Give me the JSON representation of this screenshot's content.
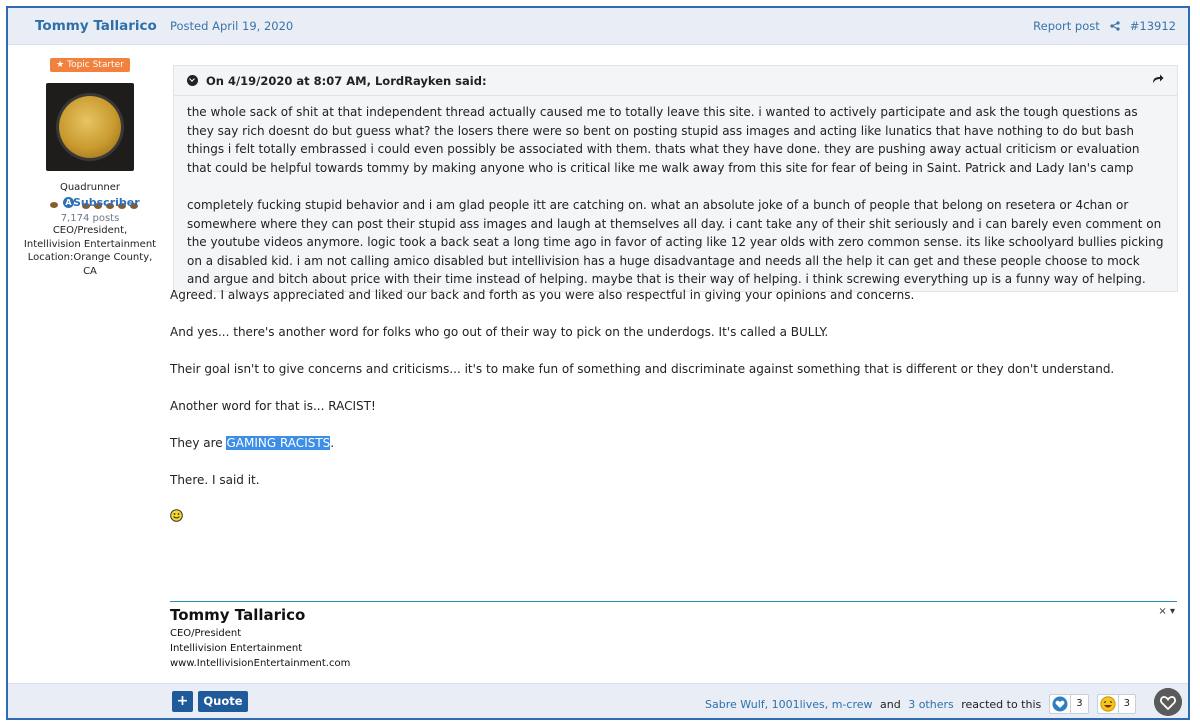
{
  "header": {
    "author": "Tommy Tallarico",
    "posted": "Posted April 19, 2020",
    "report": "Report post",
    "post_number": "#13912"
  },
  "sidebar": {
    "badge": "★ Topic Starter",
    "rank": "Quadrunner",
    "subscriber": "Subscriber",
    "posts": "7,174 posts",
    "meta": [
      "CEO/President,",
      "Intellivision Entertainment",
      "Location:Orange County,",
      "CA"
    ]
  },
  "quote": {
    "header": "On 4/19/2020 at 8:07 AM, LordRayken said:",
    "paragraphs": [
      "the whole sack of shit at that independent thread actually caused me to totally leave this site. i wanted to actively participate and ask the tough questions as they say rich doesnt do but guess what? the losers there were so bent on posting stupid ass images and acting like lunatics that have nothing to do but bash things i felt totally embrassed i could even possibly be associated with them. thats what they have done. they are pushing away actual criticism or evaluation that could be helpful towards tommy by making anyone who is critical like me walk away from this site for fear of being in Saint. Patrick and Lady Ian's camp",
      "completely fucking stupid behavior and i am glad people itt are catching on. what an absolute joke of a bunch of people that belong on resetera or 4chan or somewhere where they can post their stupid ass images and laugh at themselves all day. i cant take any of their shit seriously and i can barely even comment on the youtube videos anymore. logic took a back seat a long time ago in favor of acting like 12 year olds with zero common sense. its like schoolyard bullies picking on a disabled kid. i am not calling amico disabled but intellivision has a huge disadvantage and needs all the help it can get and these people choose to mock and argue and bitch about price with their time instead of helping. maybe that is their way of helping. i think screwing everything up is a funny way of helping."
    ]
  },
  "message": {
    "p1": "Agreed.  I always appreciated and liked our back and forth as you were also respectful in giving your opinions and concerns.",
    "p2": "And yes... there's another word for folks who go out of their way to pick on the underdogs.  It's called a BULLY.",
    "p3": "Their goal isn't to give concerns and criticisms... it's to make fun of something and discriminate against something that is different or they don't understand.",
    "p4": "Another word for that is...  RACIST!",
    "p5_pre": "They are ",
    "p5_hl": "GAMING RACISTS",
    "p5_post": ".",
    "p6": "There.  I said it."
  },
  "signature": {
    "name": "Tommy Tallarico",
    "lines": [
      "CEO/President",
      "Intellivision Entertainment",
      "www.IntellivisionEntertainment.com"
    ],
    "controls": "× ▾"
  },
  "footer": {
    "plus": "+",
    "quote": "Quote",
    "reactors": "Sabre Wulf, 1001lives, m-crew",
    "and": " and ",
    "others": "3 others",
    "suffix": " reacted to this",
    "like_count": "3",
    "haha_count": "3"
  },
  "colors": {
    "accent": "#2e6bb3",
    "header_bg": "#e9eef6",
    "highlight": "#3c8ee6",
    "badge": "#f2813e"
  }
}
